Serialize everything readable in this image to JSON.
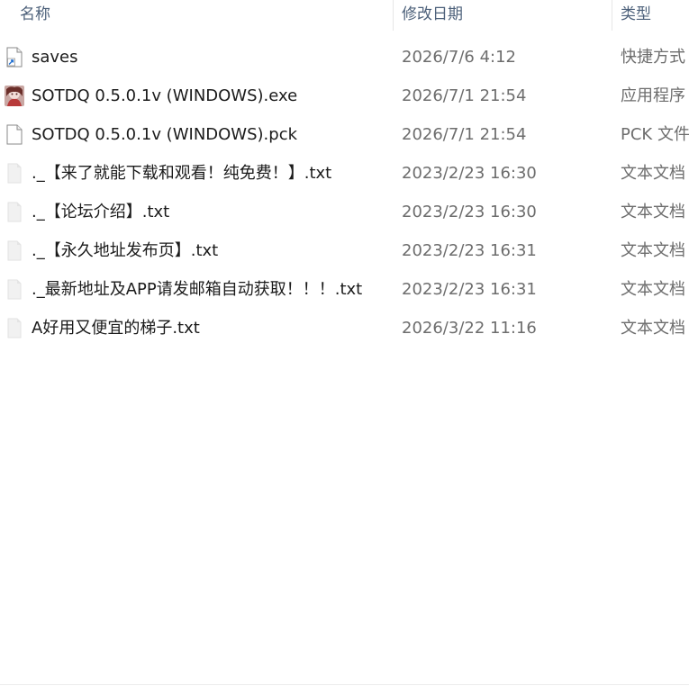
{
  "columns": {
    "name": "名称",
    "date_modified": "修改日期",
    "type": "类型"
  },
  "files": [
    {
      "icon": "shortcut-file-icon",
      "name": "saves",
      "date": "2026/7/6 4:12",
      "type": "快捷方式"
    },
    {
      "icon": "application-icon",
      "name": "SOTDQ 0.5.0.1v (WINDOWS).exe",
      "date": "2026/7/1 21:54",
      "type": "应用程序"
    },
    {
      "icon": "blank-file-icon",
      "name": "SOTDQ 0.5.0.1v (WINDOWS).pck",
      "date": "2026/7/1 21:54",
      "type": "PCK 文件"
    },
    {
      "icon": "text-file-icon",
      "name": "._【来了就能下载和观看！纯免费！】.txt",
      "date": "2023/2/23 16:30",
      "type": "文本文档"
    },
    {
      "icon": "text-file-icon",
      "name": "._【论坛介绍】.txt",
      "date": "2023/2/23 16:30",
      "type": "文本文档"
    },
    {
      "icon": "text-file-icon",
      "name": "._【永久地址发布页】.txt",
      "date": "2023/2/23 16:31",
      "type": "文本文档"
    },
    {
      "icon": "text-file-icon",
      "name": "._最新地址及APP请发邮箱自动获取！！！.txt",
      "date": "2023/2/23 16:31",
      "type": "文本文档"
    },
    {
      "icon": "text-file-icon",
      "name": "A好用又便宜的梯子.txt",
      "date": "2026/3/22 11:16",
      "type": "文本文档"
    }
  ]
}
